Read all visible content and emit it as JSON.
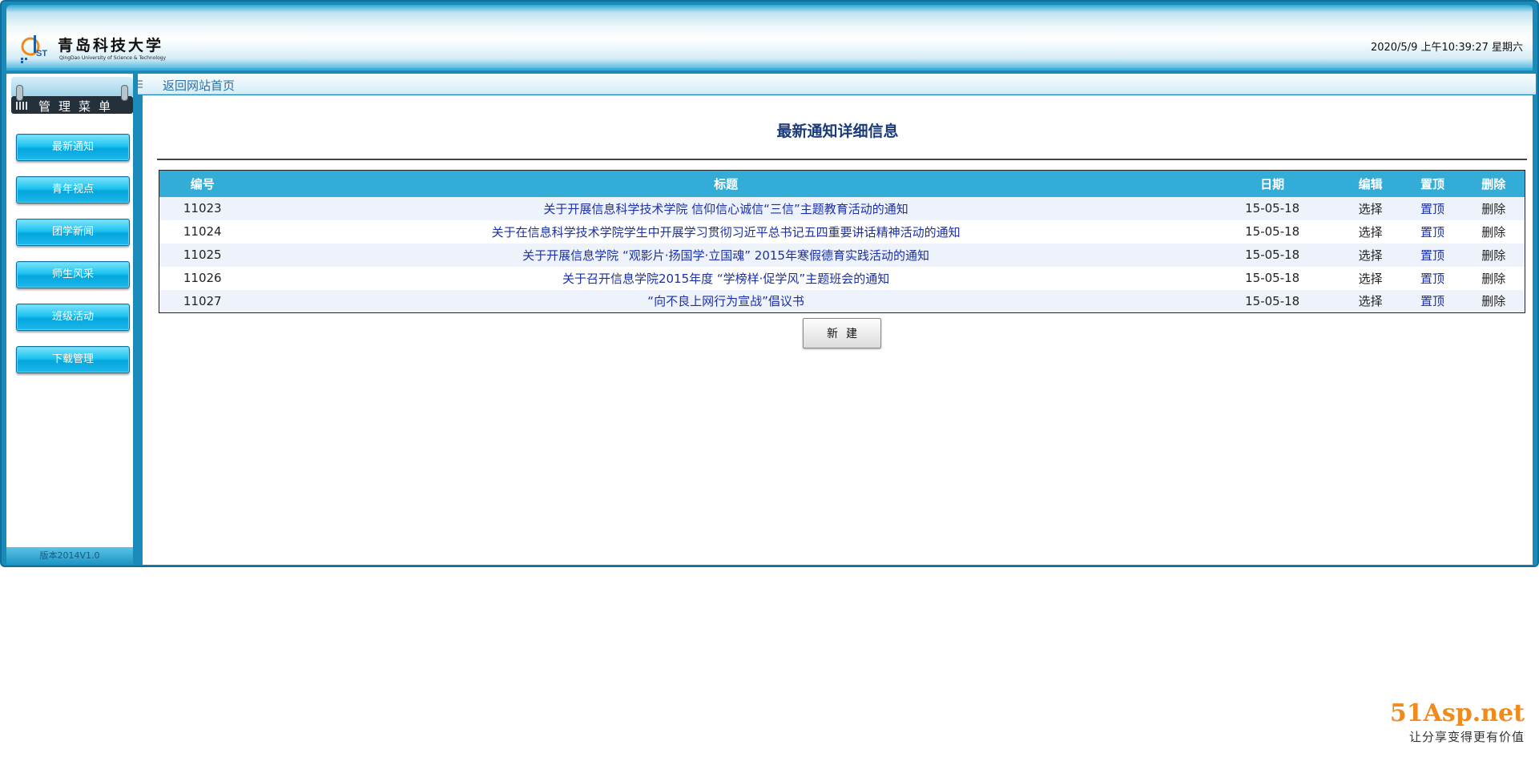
{
  "header": {
    "logo_text_cn": "青岛科技大学",
    "logo_text_en": "QingDao University of Science & Technology",
    "datetime": "2020/5/9 上午10:39:27 星期六"
  },
  "nav": {
    "home_link": "返回网站首页"
  },
  "sidebar": {
    "title": "管理菜单",
    "items": [
      {
        "label": "最新通知"
      },
      {
        "label": "青年视点"
      },
      {
        "label": "团学新闻"
      },
      {
        "label": "师生风采"
      },
      {
        "label": "班级活动"
      },
      {
        "label": "下载管理"
      }
    ],
    "version": "版本2014V1.0"
  },
  "main": {
    "title": "最新通知详细信息",
    "table": {
      "headers": {
        "id": "编号",
        "title": "标题",
        "date": "日期",
        "edit": "编辑",
        "top": "置顶",
        "delete": "删除"
      },
      "rows": [
        {
          "id": "11023",
          "title": "关于开展信息科学技术学院 信仰信心诚信“三信”主题教育活动的通知",
          "date": "15-05-18",
          "edit": "选择",
          "top": "置顶",
          "delete": "删除"
        },
        {
          "id": "11024",
          "title": "关于在信息科学技术学院学生中开展学习贯彻习近平总书记五四重要讲话精神活动的通知",
          "date": "15-05-18",
          "edit": "选择",
          "top": "置顶",
          "delete": "删除"
        },
        {
          "id": "11025",
          "title": "关于开展信息学院 “观影片·扬国学·立国魂” 2015年寒假德育实践活动的通知",
          "date": "15-05-18",
          "edit": "选择",
          "top": "置顶",
          "delete": "删除"
        },
        {
          "id": "11026",
          "title": "关于召开信息学院2015年度 “学榜样·促学风”主题班会的通知",
          "date": "15-05-18",
          "edit": "选择",
          "top": "置顶",
          "delete": "删除"
        },
        {
          "id": "11027",
          "title": "“向不良上网行为宣战”倡议书",
          "date": "15-05-18",
          "edit": "选择",
          "top": "置顶",
          "delete": "删除"
        }
      ]
    },
    "new_button": "新建"
  },
  "watermark": {
    "logo": "51Asp.net",
    "tagline": "让分享变得更有价值"
  },
  "colors": {
    "frame": "#1a8ab8",
    "header_bar": "#34acd8",
    "link": "#1a2fa8",
    "title": "#1a3a78",
    "menu_button": "#05a6dd"
  }
}
